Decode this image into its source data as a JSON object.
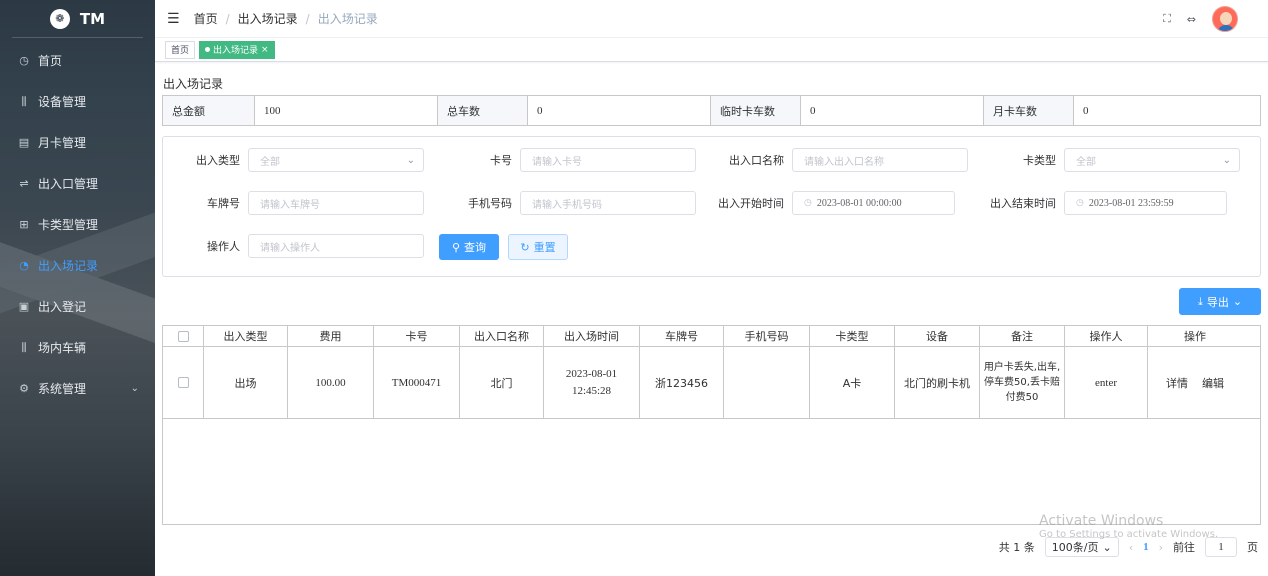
{
  "app": {
    "logo_mark": "❁",
    "name": "TM"
  },
  "sidebar": {
    "items": [
      {
        "icon": "◷",
        "label": "首页"
      },
      {
        "icon": "⫼",
        "label": "设备管理"
      },
      {
        "icon": "▤",
        "label": "月卡管理"
      },
      {
        "icon": "⇌",
        "label": "出入口管理"
      },
      {
        "icon": "⊞",
        "label": "卡类型管理"
      },
      {
        "icon": "◔",
        "label": "出入场记录"
      },
      {
        "icon": "▣",
        "label": "出入登记"
      },
      {
        "icon": "⫼",
        "label": "场内车辆"
      },
      {
        "icon": "⚙",
        "label": "系统管理",
        "arrow": "⌄"
      }
    ]
  },
  "navbar": {
    "menu_icon": "☰",
    "breadcrumb": [
      "首页",
      "出入场记录",
      "出入场记录"
    ],
    "separator": "/",
    "fullscreen_icon": "⛶",
    "size_icon": "⇔"
  },
  "tags": {
    "home": "首页",
    "active": "出入场记录",
    "close": "×"
  },
  "page_title": "出入场记录",
  "summary": [
    {
      "label": "总金额",
      "value": "100"
    },
    {
      "label": "总车数",
      "value": "0"
    },
    {
      "label": "临时卡车数",
      "value": "0"
    },
    {
      "label": "月卡车数",
      "value": "0"
    }
  ],
  "search": {
    "type_label": "出入类型",
    "type_value": "全部",
    "card_label": "卡号",
    "card_placeholder": "请输入卡号",
    "gate_label": "出入口名称",
    "gate_placeholder": "请输入出入口名称",
    "cardtype_label": "卡类型",
    "cardtype_value": "全部",
    "plate_label": "车牌号",
    "plate_placeholder": "请输入车牌号",
    "phone_label": "手机号码",
    "phone_placeholder": "请输入手机号码",
    "start_label": "出入开始时间",
    "start_value": "2023-08-01 00:00:00",
    "end_label": "出入结束时间",
    "end_value": "2023-08-01 23:59:59",
    "operator_label": "操作人",
    "operator_placeholder": "请输入操作人",
    "query": "查询",
    "reset": "重置",
    "query_icon": "⚲",
    "reset_icon": "↻",
    "chevron": "⌄",
    "clock": "◷"
  },
  "export": {
    "label": "导出",
    "icon": "⤓",
    "chevron": "⌄"
  },
  "table": {
    "headers": [
      "出入类型",
      "费用",
      "卡号",
      "出入口名称",
      "出入场时间",
      "车牌号",
      "手机号码",
      "卡类型",
      "设备",
      "备注",
      "操作人",
      "操作"
    ],
    "rows": [
      {
        "type": "出场",
        "fee": "100.00",
        "card": "TM000471",
        "gate": "北门",
        "time": "2023-08-01 12:45:28",
        "plate": "浙123456",
        "phone": "",
        "card_type": "A卡",
        "device": "北门的刷卡机",
        "remark": "用户卡丢失,出车,停车费50,丢卡赔付费50",
        "operator": "enter",
        "detail": "详情",
        "edit": "编辑"
      }
    ]
  },
  "pagination": {
    "total": "共 1 条",
    "page_size": "100条/页",
    "current": "1",
    "prev": "‹",
    "next": "›",
    "goto_prefix": "前往",
    "goto_value": "1",
    "goto_suffix": "页"
  },
  "watermark": {
    "line1": "Activate Windows",
    "line2": "Go to Settings to activate Windows."
  }
}
